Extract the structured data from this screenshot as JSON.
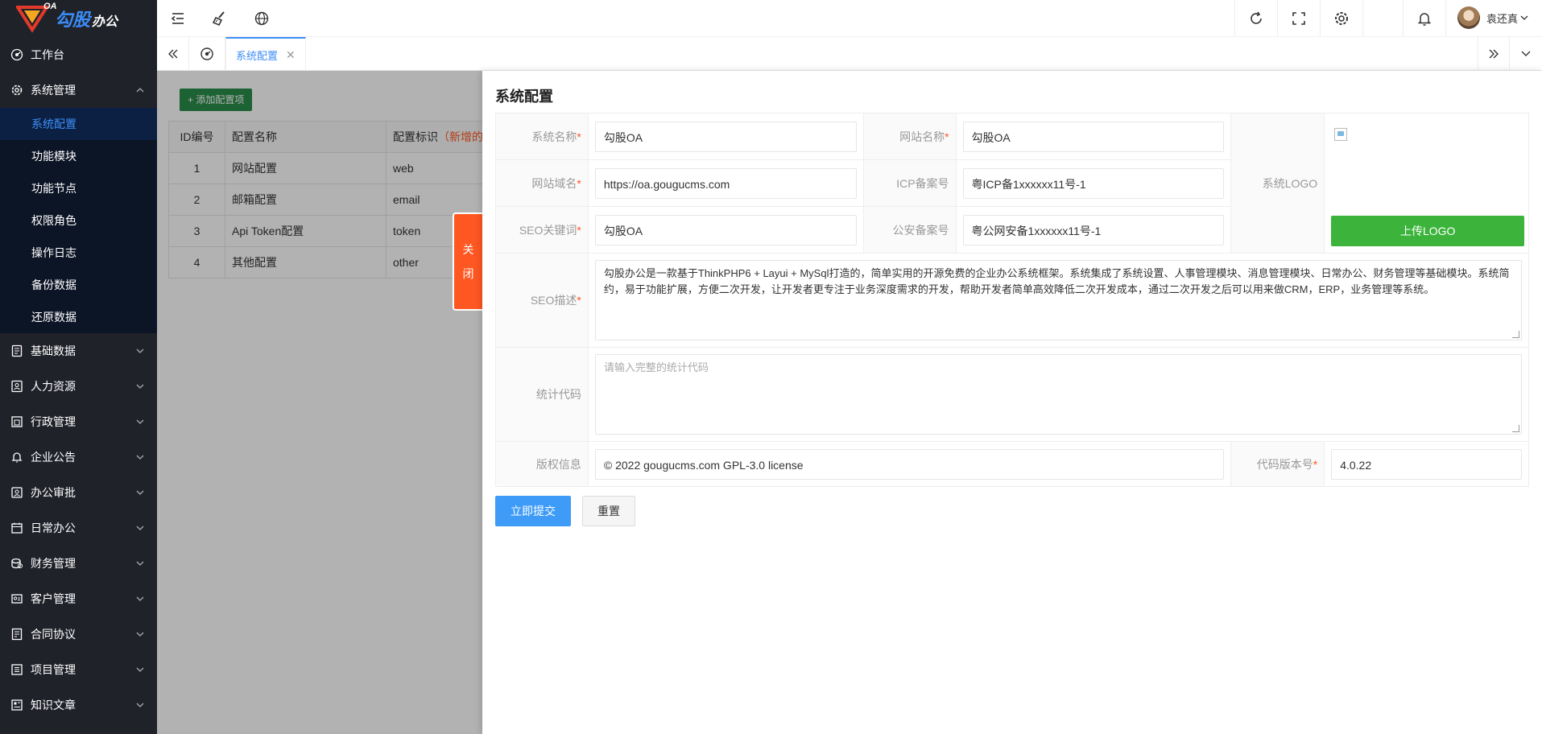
{
  "brand": {
    "name": "勾股",
    "suffix": "办公",
    "tag": "OA"
  },
  "sidebar": {
    "items": [
      {
        "label": "工作台",
        "icon": "dashboard-icon",
        "has_children": false
      },
      {
        "label": "系统管理",
        "icon": "settings-icon",
        "has_children": true,
        "open": true,
        "children": [
          "系统配置",
          "功能模块",
          "功能节点",
          "权限角色",
          "操作日志",
          "备份数据",
          "还原数据"
        ],
        "active_child": "系统配置"
      },
      {
        "label": "基础数据",
        "icon": "database-icon",
        "has_children": true
      },
      {
        "label": "人力资源",
        "icon": "person-badge-icon",
        "has_children": true
      },
      {
        "label": "行政管理",
        "icon": "folder-icon",
        "has_children": true
      },
      {
        "label": "企业公告",
        "icon": "bell-icon",
        "has_children": true
      },
      {
        "label": "办公审批",
        "icon": "approval-icon",
        "has_children": true
      },
      {
        "label": "日常办公",
        "icon": "calendar-icon",
        "has_children": true
      },
      {
        "label": "财务管理",
        "icon": "money-icon",
        "has_children": true
      },
      {
        "label": "客户管理",
        "icon": "customer-icon",
        "has_children": true
      },
      {
        "label": "合同协议",
        "icon": "contract-icon",
        "has_children": true
      },
      {
        "label": "项目管理",
        "icon": "project-icon",
        "has_children": true
      },
      {
        "label": "知识文章",
        "icon": "article-icon",
        "has_children": true
      }
    ]
  },
  "topbar": {
    "left_icons": [
      "menu-toggle-icon",
      "clear-cache-icon",
      "globe-icon"
    ],
    "right_icons": [
      "refresh-icon",
      "fullscreen-icon",
      "gear-icon",
      "bell-icon"
    ],
    "user_name": "袁还真"
  },
  "tabs": {
    "items": [
      {
        "label": "系统配置",
        "active": true
      }
    ]
  },
  "background": {
    "add_button": "+ 添加配置项",
    "columns": [
      "ID编号",
      "配置名称",
      "配置标识"
    ],
    "column_hint": "（新增的",
    "rows": [
      {
        "id": "1",
        "name": "网站配置",
        "key": "web"
      },
      {
        "id": "2",
        "name": "邮箱配置",
        "key": "email"
      },
      {
        "id": "3",
        "name": "Api Token配置",
        "key": "token"
      },
      {
        "id": "4",
        "name": "其他配置",
        "key": "other"
      }
    ]
  },
  "panel": {
    "close_label_1": "关",
    "close_label_2": "闭",
    "title": "系统配置",
    "fields": {
      "system_name": {
        "label": "系统名称",
        "value": "勾股OA",
        "required": true
      },
      "site_name": {
        "label": "网站名称",
        "value": "勾股OA",
        "required": true
      },
      "domain": {
        "label": "网站域名",
        "value": "https://oa.gougucms.com",
        "required": true
      },
      "icp": {
        "label": "ICP备案号",
        "value": "粤ICP备1xxxxxx11号-1",
        "required": false
      },
      "seo_keywords": {
        "label": "SEO关键词",
        "value": "勾股OA",
        "required": true
      },
      "police": {
        "label": "公安备案号",
        "value": "粤公网安备1xxxxxx11号-1",
        "required": false
      },
      "logo": {
        "label": "系统LOGO",
        "upload_label": "上传LOGO"
      },
      "seo_desc": {
        "label": "SEO描述",
        "value": "勾股办公是一款基于ThinkPHP6 + Layui + MySql打造的，简单实用的开源免费的企业办公系统框架。系统集成了系统设置、人事管理模块、消息管理模块、日常办公、财务管理等基础模块。系统简约，易于功能扩展，方便二次开发，让开发者更专注于业务深度需求的开发，帮助开发者简单高效降低二次开发成本，通过二次开发之后可以用来做CRM，ERP，业务管理等系统。",
        "required": true
      },
      "stat_code": {
        "label": "统计代码",
        "placeholder": "请输入完整的统计代码",
        "value": ""
      },
      "copyright": {
        "label": "版权信息",
        "value": "© 2022 gougucms.com GPL-3.0 license"
      },
      "version": {
        "label": "代码版本号",
        "value": "4.0.22",
        "required": true
      }
    },
    "submit_label": "立即提交",
    "reset_label": "重置"
  },
  "colors": {
    "sidebar_bg": "#20222a",
    "accent": "#3e8ef7",
    "close_tab": "#ff5722",
    "upload": "#3cb43c",
    "add_btn": "#2a8d4a"
  }
}
